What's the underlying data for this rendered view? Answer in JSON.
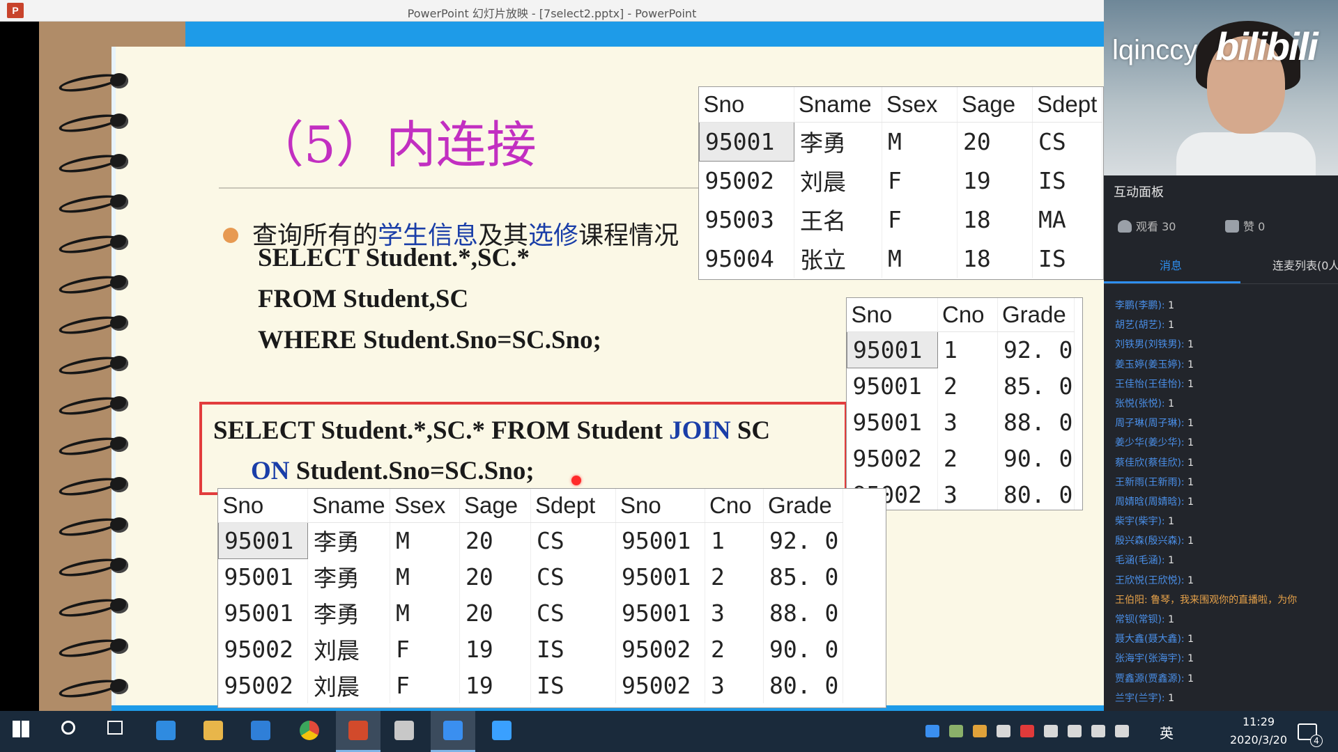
{
  "window": {
    "app_icon": "P",
    "title": "PowerPoint 幻灯片放映 - [7select2.pptx] - PowerPoint"
  },
  "slide": {
    "title": "（5）内连接",
    "bullet_parts": [
      "查询所有的",
      "学生信息",
      "及其",
      "选修",
      "课程情况"
    ],
    "sql_lines": [
      "SELECT Student.*,SC.*",
      "FROM Student,SC",
      "WHERE Student.Sno=SC.Sno;"
    ],
    "join_sql": {
      "line1_prefix": "SELECT Student.*,SC.* FROM Student ",
      "line1_keyword": "JOIN",
      "line1_suffix": " SC",
      "line2_keyword": "ON",
      "line2_suffix": " Student.Sno=SC.Sno;"
    },
    "student_table": {
      "headers": [
        "Sno",
        "Sname",
        "Ssex",
        "Sage",
        "Sdept"
      ],
      "rows": [
        [
          "95001",
          "李勇",
          "M",
          "20",
          "CS"
        ],
        [
          "95002",
          "刘晨",
          "F",
          "19",
          "IS"
        ],
        [
          "95003",
          "王名",
          "F",
          "18",
          "MA"
        ],
        [
          "95004",
          "张立",
          "M",
          "18",
          "IS"
        ]
      ]
    },
    "sc_table": {
      "headers": [
        "Sno",
        "Cno",
        "Grade"
      ],
      "rows": [
        [
          "95001",
          "1",
          "92. 0"
        ],
        [
          "95001",
          "2",
          "85. 0"
        ],
        [
          "95001",
          "3",
          "88. 0"
        ],
        [
          "95002",
          "2",
          "90. 0"
        ],
        [
          "95002",
          "3",
          "80. 0"
        ]
      ]
    },
    "result_table": {
      "headers": [
        "Sno",
        "Sname",
        "Ssex",
        "Sage",
        "Sdept",
        "Sno",
        "Cno",
        "Grade"
      ],
      "rows": [
        [
          "95001",
          "李勇",
          "M",
          "20",
          "CS",
          "95001",
          "1",
          "92. 0"
        ],
        [
          "95001",
          "李勇",
          "M",
          "20",
          "CS",
          "95001",
          "2",
          "85. 0"
        ],
        [
          "95001",
          "李勇",
          "M",
          "20",
          "CS",
          "95001",
          "3",
          "88. 0"
        ],
        [
          "95002",
          "刘晨",
          "F",
          "19",
          "IS",
          "95002",
          "2",
          "90. 0"
        ],
        [
          "95002",
          "刘晨",
          "F",
          "19",
          "IS",
          "95002",
          "3",
          "80. 0"
        ]
      ]
    }
  },
  "live_panel": {
    "streamer": "lqinccy",
    "logo": "bilibili",
    "title": "互动面板",
    "viewers": "观看 30",
    "likes": "赞 0",
    "tabs": [
      "消息",
      "连麦列表(0人"
    ],
    "messages": [
      {
        "who": "李鹏(李鹏):",
        "text": " 1"
      },
      {
        "who": "胡艺(胡艺):",
        "text": " 1"
      },
      {
        "who": "刘铁男(刘铁男):",
        "text": " 1"
      },
      {
        "who": "姜玉婷(姜玉婷):",
        "text": " 1"
      },
      {
        "who": "王佳怡(王佳怡):",
        "text": " 1"
      },
      {
        "who": "张悦(张悦):",
        "text": " 1"
      },
      {
        "who": "周子琳(周子琳):",
        "text": " 1"
      },
      {
        "who": "姜少华(姜少华):",
        "text": " 1"
      },
      {
        "who": "蔡佳欣(蔡佳欣):",
        "text": " 1"
      },
      {
        "who": "王新雨(王新雨):",
        "text": " 1"
      },
      {
        "who": "周婧晗(周婧晗):",
        "text": " 1"
      },
      {
        "who": "柴宇(柴宇):",
        "text": " 1"
      },
      {
        "who": "殷兴森(殷兴森):",
        "text": " 1"
      },
      {
        "who": "毛涵(毛涵):",
        "text": " 1"
      },
      {
        "who": "王欣悦(王欣悦):",
        "text": " 1"
      },
      {
        "who": "王伯阳:",
        "text": " 鲁琴，我来围观你的直播啦，为你",
        "special": true
      },
      {
        "who": "常钡(常钡):",
        "text": " 1"
      },
      {
        "who": "聂大鑫(聂大鑫):",
        "text": " 1"
      },
      {
        "who": "张海宇(张海宇):",
        "text": " 1"
      },
      {
        "who": "贾鑫源(贾鑫源):",
        "text": " 1"
      },
      {
        "who": "兰宇(兰宇):",
        "text": " 1"
      }
    ]
  },
  "taskbar": {
    "ime_lang": "英",
    "time": "11:29",
    "date": "2020/3/20",
    "notifications": "4",
    "apps": [
      "start-icon",
      "search-icon",
      "task-view-icon",
      "edge-icon",
      "file-explorer-icon",
      "store-icon",
      "chrome-icon",
      "powerpoint-icon",
      "tools-icon",
      "feishu-icon",
      "calendar-app-icon"
    ]
  }
}
